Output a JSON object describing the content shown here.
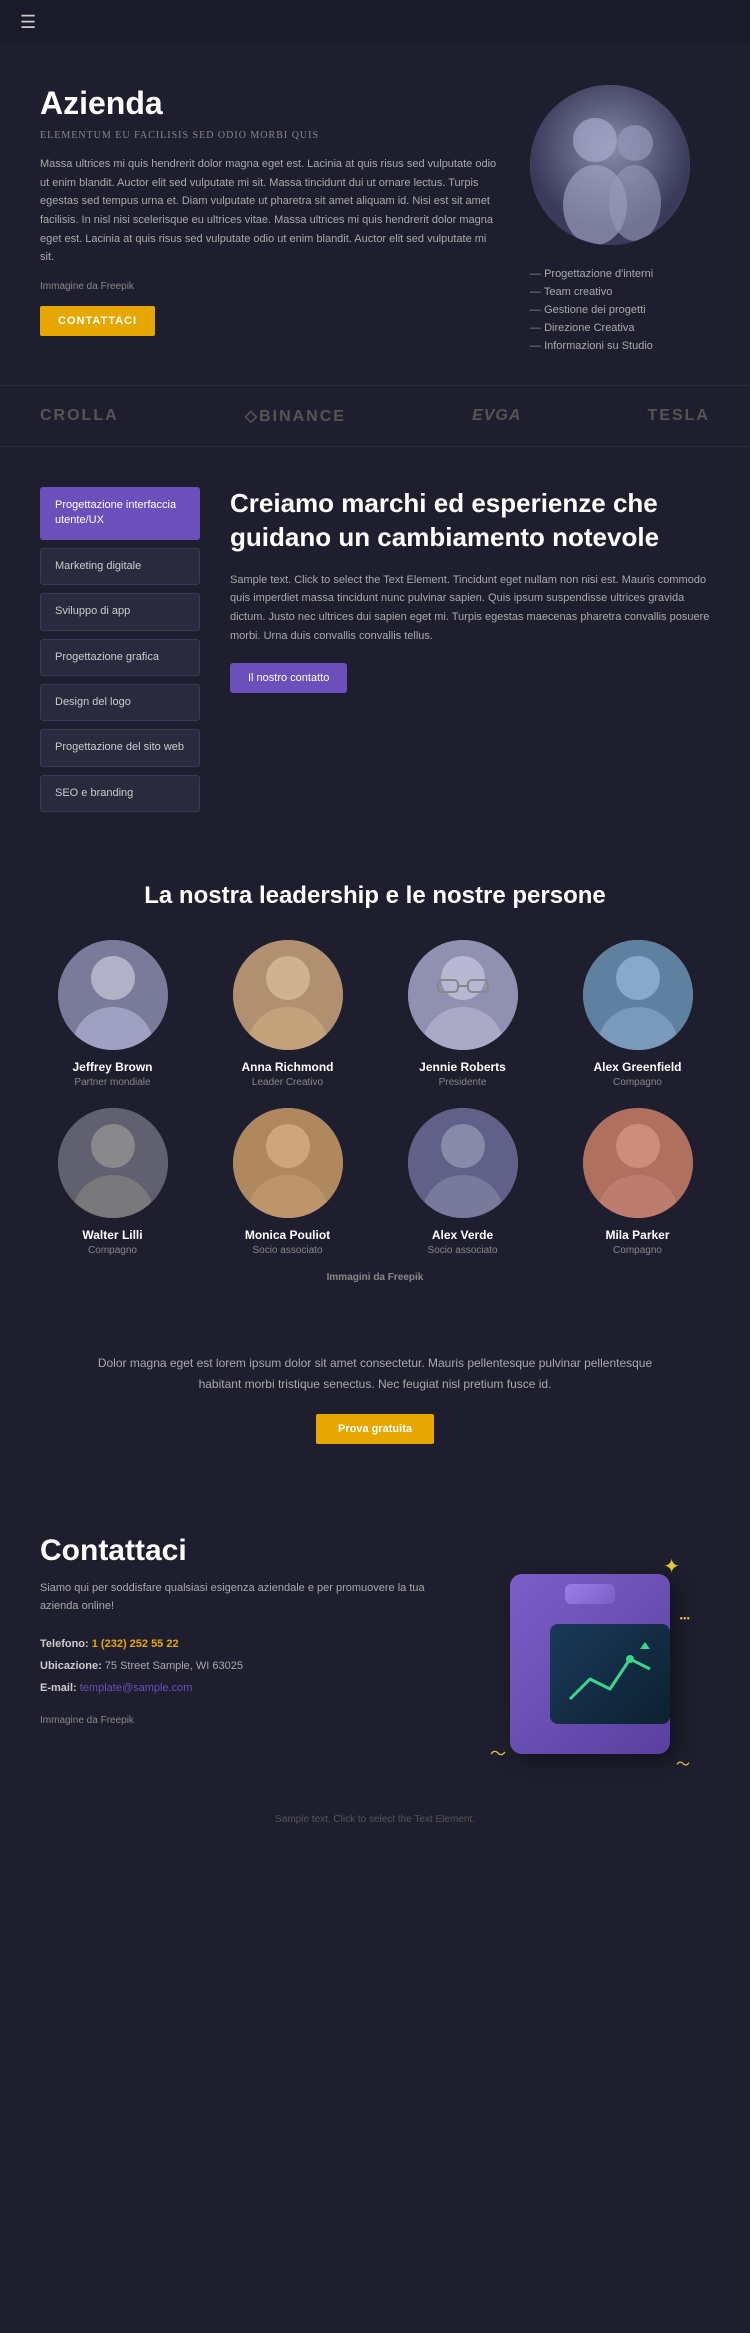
{
  "nav": {
    "menu_icon": "☰"
  },
  "hero": {
    "title": "Azienda",
    "subtitle": "ELEMENTUM EU FACILISIS SED ODIO MORBI QUIS",
    "body_text": "Massa ultrices mi quis hendrerit dolor magna eget est. Lacinia at quis risus sed vulputate odio ut enim blandit. Auctor elit sed vulputate mi sit. Massa tincidunt dui ut ornare lectus. Turpis egestas sed tempus urna et. Diam vulputate ut pharetra sit amet aliquam id. Nisi est sit amet facilisis. In nisl nisi scelerisque eu ultrices vitae. Massa ultrices mi quis hendrerit dolor magna eget est. Lacinia at quis risus sed vulputate odio ut enim blandit. Auctor elit sed vulputate mi sit.",
    "image_credit": "Immagine da Freepik",
    "image_credit_brand": "Freepik",
    "contact_button": "CONTATTACI",
    "list_items": [
      "Progettazione d'interni",
      "Team creativo",
      "Gestione dei progetti",
      "Direzione Creativa",
      "Informazioni su Studio"
    ]
  },
  "logos": {
    "items": [
      {
        "name": "CROLLA",
        "class": ""
      },
      {
        "name": "◇BINANCE",
        "class": "binance"
      },
      {
        "name": "EVGA",
        "class": ""
      },
      {
        "name": "TESLA",
        "class": ""
      }
    ]
  },
  "services": {
    "buttons": [
      {
        "label": "Progettazione interfaccia utente/UX",
        "active": true
      },
      {
        "label": "Marketing digitale",
        "active": false
      },
      {
        "label": "Sviluppo di app",
        "active": false
      },
      {
        "label": "Progettazione grafica",
        "active": false
      },
      {
        "label": "Design del logo",
        "active": false
      },
      {
        "label": "Progettazione del sito web",
        "active": false
      },
      {
        "label": "SEO e branding",
        "active": false
      }
    ],
    "title": "Creiamo marchi ed esperienze che guidano un cambiamento notevole",
    "body_text": "Sample text. Click to select the Text Element. Tincidunt eget nullam non nisi est. Mauris commodo quis imperdiet massa tincidunt nunc pulvinar sapien. Quis ipsum suspendisse ultrices gravida dictum. Justo nec ultrices dui sapien eget mi. Turpis egestas maecenas pharetra convallis posuere morbi. Urna duis convallis convallis tellus.",
    "contact_button": "Il nostro contatto"
  },
  "team": {
    "title": "La nostra leadership e le nostre persone",
    "members": [
      {
        "name": "Jeffrey Brown",
        "role": "Partner mondiale",
        "avatar_class": "avatar-1"
      },
      {
        "name": "Anna Richmond",
        "role": "Leader Creativo",
        "avatar_class": "avatar-2"
      },
      {
        "name": "Jennie Roberts",
        "role": "Presidente",
        "avatar_class": "avatar-3"
      },
      {
        "name": "Alex Greenfield",
        "role": "Compagno",
        "avatar_class": "avatar-4"
      },
      {
        "name": "Walter Lilli",
        "role": "Compagno",
        "avatar_class": "avatar-5"
      },
      {
        "name": "Monica Pouliot",
        "role": "Socio associato",
        "avatar_class": "avatar-6"
      },
      {
        "name": "Alex Verde",
        "role": "Socio associato",
        "avatar_class": "avatar-7"
      },
      {
        "name": "Mila Parker",
        "role": "Compagno",
        "avatar_class": "avatar-8"
      }
    ],
    "image_credit_prefix": "Immagini da ",
    "image_credit_brand": "Freepik"
  },
  "cta": {
    "text": "Dolor magna eget est lorem ipsum dolor sit amet consectetur. Mauris pellentesque pulvinar pellentesque habitant morbi tristique senectus. Nec feugiat nisl pretium fusce id.",
    "button_label": "Prova gratuita"
  },
  "contact": {
    "title": "Contattaci",
    "intro": "Siamo qui per soddisfare qualsiasi esigenza aziendale e per promuovere la tua azienda online!",
    "phone_label": "Telefono:",
    "phone_number": "1 (232) 252 55 22",
    "address_label": "Ubicazione:",
    "address_value": "75 Street Sample, WI 63025",
    "email_label": "E-mail:",
    "email_value": "template@sample.com",
    "image_credit": "Immagine da Freepik"
  },
  "footer": {
    "text": "Sample text. Click to select the Text Element."
  }
}
